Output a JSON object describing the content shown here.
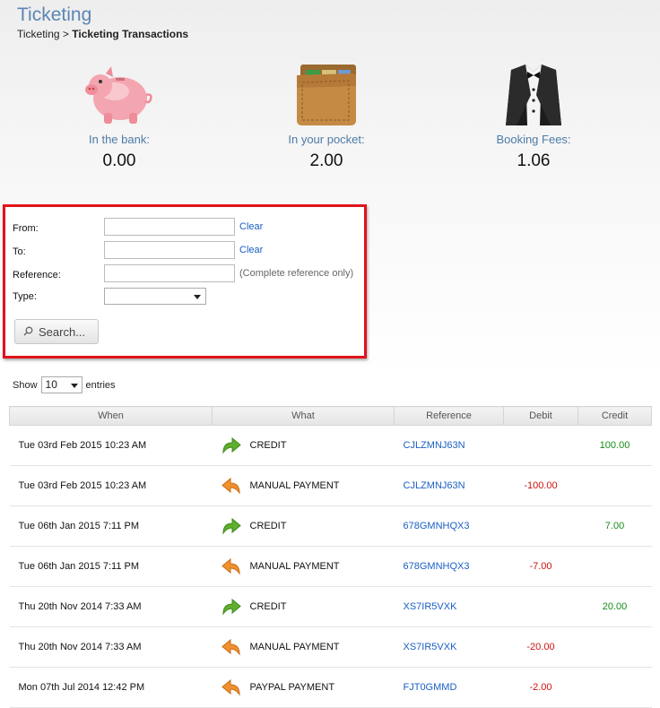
{
  "header": {
    "title": "Ticketing",
    "breadcrumb_parent": "Ticketing",
    "breadcrumb_sep": ">",
    "breadcrumb_current": "Ticketing Transactions"
  },
  "stats": [
    {
      "label": "In the bank:",
      "value": "0.00",
      "icon": "piggy-bank-icon"
    },
    {
      "label": "In your pocket:",
      "value": "2.00",
      "icon": "wallet-icon"
    },
    {
      "label": "Booking Fees:",
      "value": "1.06",
      "icon": "tuxedo-icon"
    }
  ],
  "filter": {
    "from_label": "From:",
    "to_label": "To:",
    "reference_label": "Reference:",
    "type_label": "Type:",
    "from_value": "",
    "to_value": "",
    "reference_value": "",
    "type_value": "",
    "clear_label": "Clear",
    "reference_hint": "(Complete reference only)",
    "search_label": "Search..."
  },
  "list": {
    "show_label": "Show",
    "entries_value": "10",
    "entries_label": "entries"
  },
  "table": {
    "columns": [
      "When",
      "What",
      "Reference",
      "Debit",
      "Credit"
    ],
    "rows": [
      {
        "when": "Tue 03rd Feb 2015 10:23 AM",
        "what": "CREDIT",
        "icon": "credit-arrow-icon",
        "ref": "CJLZMNJ63N",
        "debit": "",
        "credit": "100.00"
      },
      {
        "when": "Tue 03rd Feb 2015 10:23 AM",
        "what": "MANUAL PAYMENT",
        "icon": "payment-arrow-icon",
        "ref": "CJLZMNJ63N",
        "debit": "-100.00",
        "credit": ""
      },
      {
        "when": "Tue 06th Jan 2015 7:11 PM",
        "what": "CREDIT",
        "icon": "credit-arrow-icon",
        "ref": "678GMNHQX3",
        "debit": "",
        "credit": "7.00"
      },
      {
        "when": "Tue 06th Jan 2015 7:11 PM",
        "what": "MANUAL PAYMENT",
        "icon": "payment-arrow-icon",
        "ref": "678GMNHQX3",
        "debit": "-7.00",
        "credit": ""
      },
      {
        "when": "Thu 20th Nov 2014 7:33 AM",
        "what": "CREDIT",
        "icon": "credit-arrow-icon",
        "ref": "XS7IR5VXK",
        "debit": "",
        "credit": "20.00"
      },
      {
        "when": "Thu 20th Nov 2014 7:33 AM",
        "what": "MANUAL PAYMENT",
        "icon": "payment-arrow-icon",
        "ref": "XS7IR5VXK",
        "debit": "-20.00",
        "credit": ""
      },
      {
        "when": "Mon 07th Jul 2014 12:42 PM",
        "what": "PAYPAL PAYMENT",
        "icon": "payment-arrow-icon",
        "ref": "FJT0GMMD",
        "debit": "-2.00",
        "credit": ""
      }
    ]
  },
  "colors": {
    "accent": "#5a86b5",
    "link": "#1a5fc4",
    "debit": "#cc1111",
    "credit": "#178a17",
    "highlight_border": "#e0141a"
  }
}
